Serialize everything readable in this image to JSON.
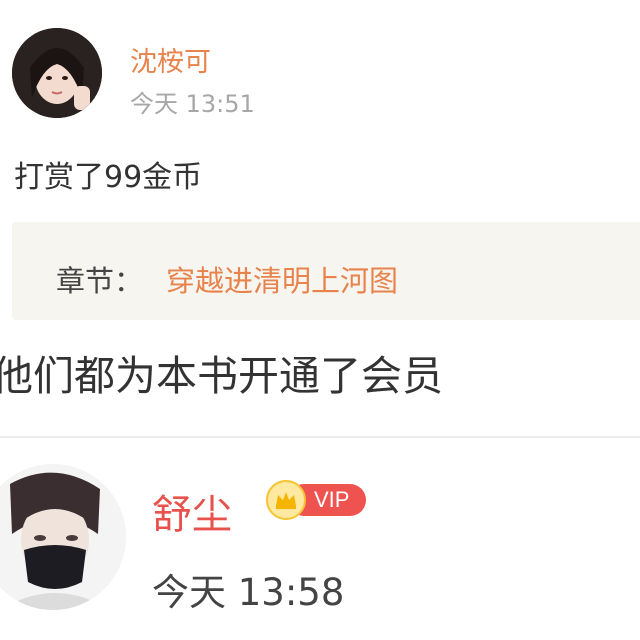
{
  "post1": {
    "username": "沈桉可",
    "time": "今天 13:51",
    "message": "打赏了99金币",
    "chapter_label": "章节：",
    "chapter_title": "穿越进清明上河图"
  },
  "members_line": "他们都为本书开通了会员",
  "post2": {
    "username": "舒尘",
    "badge": "VIP",
    "time": "今天 13:58"
  },
  "colors": {
    "orange_name": "#e8834c",
    "red_name": "#e8524c",
    "vip_red": "#ef5350",
    "gray_time": "#a7a7a7"
  }
}
